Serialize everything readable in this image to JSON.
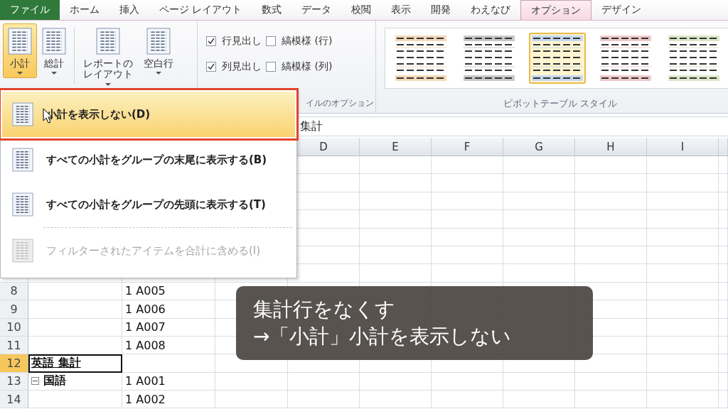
{
  "tabs": [
    {
      "label": "ファイル",
      "kind": "file",
      "selected": false
    },
    {
      "label": "ホーム",
      "kind": "tab",
      "selected": false
    },
    {
      "label": "挿入",
      "kind": "tab",
      "selected": false
    },
    {
      "label": "ページ レイアウト",
      "kind": "tab",
      "selected": false
    },
    {
      "label": "数式",
      "kind": "tab",
      "selected": false
    },
    {
      "label": "データ",
      "kind": "tab",
      "selected": false
    },
    {
      "label": "校閲",
      "kind": "tab",
      "selected": false
    },
    {
      "label": "表示",
      "kind": "tab",
      "selected": false
    },
    {
      "label": "開発",
      "kind": "tab",
      "selected": false
    },
    {
      "label": "わえなび",
      "kind": "tab",
      "selected": false
    },
    {
      "label": "オプション",
      "kind": "tab",
      "selected": true
    },
    {
      "label": "デザイン",
      "kind": "tab",
      "selected": false
    }
  ],
  "ribbon": {
    "layout_buttons": [
      {
        "label": "小計",
        "pressed": true
      },
      {
        "label": "総計",
        "pressed": false
      }
    ],
    "layout_buttons_2": [
      {
        "label": "レポートのレイアウト",
        "pressed": false
      },
      {
        "label": "空白行",
        "pressed": false
      }
    ],
    "options": [
      {
        "label": "行見出し",
        "checked": true
      },
      {
        "label": "縞模様 (行)",
        "checked": false
      },
      {
        "label": "列見出し",
        "checked": true
      },
      {
        "label": "縞模様 (列)",
        "checked": false
      }
    ],
    "options_label": "イルのオプション",
    "styles": [
      {
        "color": "#f3d9b8",
        "selected": false
      },
      {
        "color": "#c8c8c8",
        "selected": false
      },
      {
        "color": "#c6d7ee",
        "selected": true
      },
      {
        "color": "#f0caca",
        "selected": false
      },
      {
        "color": "#dbe6c6",
        "selected": false
      }
    ],
    "styles_label": "ピボットテーブル スタイル"
  },
  "formula_bar": {
    "value": "集計"
  },
  "columns": [
    "D",
    "E",
    "F",
    "G",
    "H",
    "I"
  ],
  "rows": [
    {
      "number": "8",
      "col_a": "",
      "col_b": "1 A005",
      "selected": false
    },
    {
      "number": "9",
      "col_a": "",
      "col_b": "1 A006",
      "selected": false
    },
    {
      "number": "10",
      "col_a": "",
      "col_b": "1 A007",
      "selected": false
    },
    {
      "number": "11",
      "col_a": "",
      "col_b": "1 A008",
      "selected": false
    },
    {
      "number": "12",
      "col_a": "英語 集計",
      "col_b": "",
      "selected": true
    },
    {
      "number": "13",
      "col_a": "国語",
      "col_b": "1 A001",
      "selected": false,
      "expanded": true
    },
    {
      "number": "14",
      "col_a": "",
      "col_b": "1 A002",
      "selected": false
    }
  ],
  "menu": [
    {
      "kind": "item",
      "label": "小計を表示しない(D)",
      "highlighted": true,
      "disabled": false
    },
    {
      "kind": "item",
      "label": "すべての小計をグループの末尾に表示する(B)",
      "highlighted": false,
      "disabled": false
    },
    {
      "kind": "item",
      "label": "すべての小計をグループの先頭に表示する(T)",
      "highlighted": false,
      "disabled": false
    },
    {
      "kind": "separator"
    },
    {
      "kind": "item",
      "label": "フィルターされたアイテムを合計に含める(I)",
      "highlighted": false,
      "disabled": true
    }
  ],
  "caption": {
    "lines": [
      "集計行をなくす",
      "→「小計」小計を表示しない"
    ]
  }
}
